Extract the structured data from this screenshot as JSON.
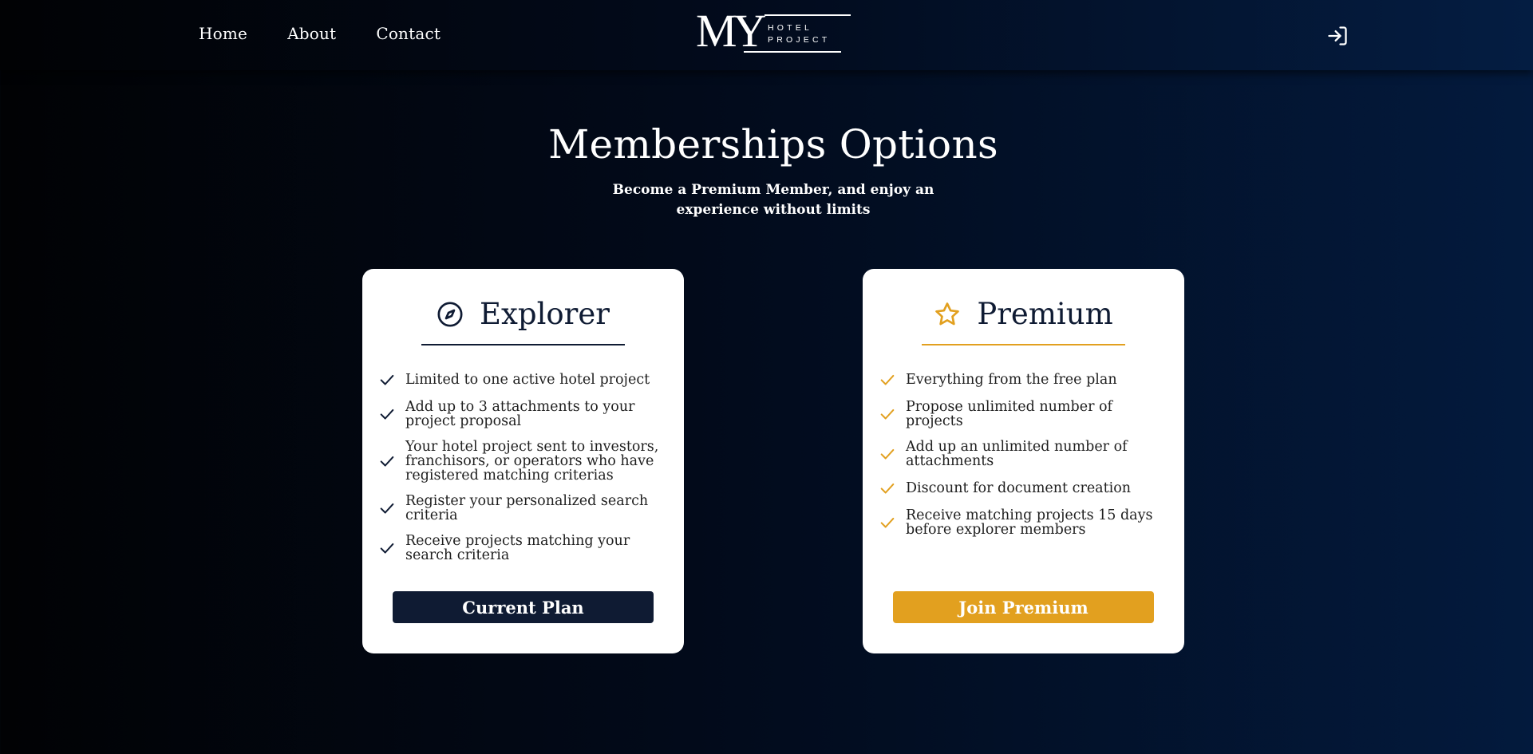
{
  "nav": {
    "items": [
      {
        "label": "Home"
      },
      {
        "label": "About"
      },
      {
        "label": "Contact"
      }
    ]
  },
  "logo": {
    "big": "MY",
    "line1": "HOTEL",
    "line2": "PROJECT"
  },
  "header": {
    "login_icon": "login-icon"
  },
  "hero": {
    "title": "Memberships Options",
    "subtitle": "Become a Premium Member, and enjoy an experience without limits"
  },
  "colors": {
    "navy": "#0f1b33",
    "gold": "#e2a01f"
  },
  "plans": [
    {
      "icon": "compass-icon",
      "title": "Explorer",
      "features": [
        "Limited to one active hotel project",
        "Add up to 3 attachments to your project proposal",
        "Your hotel project sent to investors, franchisors, or operators who have registered matching criterias",
        "Register your personalized search criteria",
        "Receive projects matching your search criteria"
      ],
      "button_label": "Current Plan"
    },
    {
      "icon": "star-icon",
      "title": "Premium",
      "features": [
        "Everything from the free plan",
        "Propose unlimited number of projects",
        "Add up an unlimited number of attachments",
        "Discount for document creation",
        "Receive matching projects 15 days before explorer members"
      ],
      "button_label": "Join Premium"
    }
  ]
}
